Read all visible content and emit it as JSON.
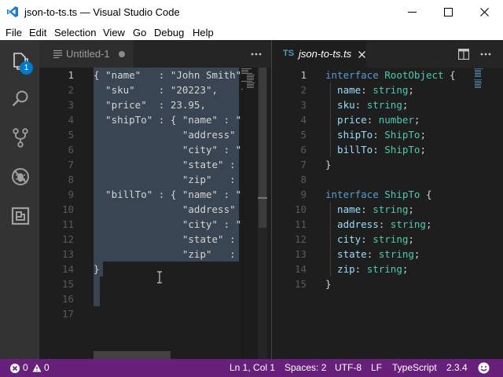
{
  "window": {
    "title": "json-to-ts.ts — Visual Studio Code"
  },
  "menu": [
    "File",
    "Edit",
    "Selection",
    "View",
    "Go",
    "Debug",
    "Help"
  ],
  "activity": {
    "explorer_badge": "1"
  },
  "left_editor": {
    "tab_label": "Untitled-1",
    "line_numbers": [
      "1",
      "2",
      "3",
      "4",
      "5",
      "6",
      "7",
      "8",
      "9",
      "10",
      "11",
      "12",
      "13",
      "14",
      "15",
      "16",
      "17"
    ],
    "lines": [
      "{ \"name\"   : \"John Smith\",",
      "  \"sku\"    : \"20223\",",
      "  \"price\"  : 23.95,",
      "  \"shipTo\" : { \"name\" : \"",
      "               \"address\"",
      "               \"city\" : \"",
      "               \"state\" : ",
      "               \"zip\"   : ",
      "  \"billTo\" : { \"name\" : \"",
      "               \"address\"",
      "               \"city\" : \"",
      "               \"state\" : ",
      "               \"zip\"   : ",
      "}",
      "",
      "",
      ""
    ]
  },
  "right_editor": {
    "tab_icon": "TS",
    "tab_label": "json-to-ts.ts",
    "line_numbers": [
      "1",
      "2",
      "3",
      "4",
      "5",
      "6",
      "7",
      "8",
      "9",
      "10",
      "11",
      "12",
      "13",
      "14",
      "15"
    ],
    "lines": [
      [
        [
          "kw",
          "interface "
        ],
        [
          "ty",
          "RootObject"
        ],
        [
          "pun",
          " {"
        ]
      ],
      [
        [
          "prop",
          "  name"
        ],
        [
          "pun",
          ": "
        ],
        [
          "ty",
          "string"
        ],
        [
          "pun",
          ";"
        ]
      ],
      [
        [
          "prop",
          "  sku"
        ],
        [
          "pun",
          ": "
        ],
        [
          "ty",
          "string"
        ],
        [
          "pun",
          ";"
        ]
      ],
      [
        [
          "prop",
          "  price"
        ],
        [
          "pun",
          ": "
        ],
        [
          "ty",
          "number"
        ],
        [
          "pun",
          ";"
        ]
      ],
      [
        [
          "prop",
          "  shipTo"
        ],
        [
          "pun",
          ": "
        ],
        [
          "ty",
          "ShipTo"
        ],
        [
          "pun",
          ";"
        ]
      ],
      [
        [
          "prop",
          "  billTo"
        ],
        [
          "pun",
          ": "
        ],
        [
          "ty",
          "ShipTo"
        ],
        [
          "pun",
          ";"
        ]
      ],
      [
        [
          "pun",
          "}"
        ]
      ],
      [],
      [
        [
          "kw",
          "interface "
        ],
        [
          "ty",
          "ShipTo"
        ],
        [
          "pun",
          " {"
        ]
      ],
      [
        [
          "prop",
          "  name"
        ],
        [
          "pun",
          ": "
        ],
        [
          "ty",
          "string"
        ],
        [
          "pun",
          ";"
        ]
      ],
      [
        [
          "prop",
          "  address"
        ],
        [
          "pun",
          ": "
        ],
        [
          "ty",
          "string"
        ],
        [
          "pun",
          ";"
        ]
      ],
      [
        [
          "prop",
          "  city"
        ],
        [
          "pun",
          ": "
        ],
        [
          "ty",
          "string"
        ],
        [
          "pun",
          ";"
        ]
      ],
      [
        [
          "prop",
          "  state"
        ],
        [
          "pun",
          ": "
        ],
        [
          "ty",
          "string"
        ],
        [
          "pun",
          ";"
        ]
      ],
      [
        [
          "prop",
          "  zip"
        ],
        [
          "pun",
          ": "
        ],
        [
          "ty",
          "string"
        ],
        [
          "pun",
          ";"
        ]
      ],
      [
        [
          "pun",
          "}"
        ]
      ]
    ]
  },
  "status": {
    "errors": "0",
    "warnings": "0",
    "position": "Ln 1, Col 1",
    "spaces": "Spaces: 2",
    "encoding": "UTF-8",
    "eol": "LF",
    "language": "TypeScript",
    "version": "2.3.4"
  },
  "colors": {
    "activity_bar": "#333333",
    "status_bar": "#68217a",
    "editor_bg": "#1e1e1e",
    "selection": "#3a4553",
    "keyword": "#569cd6",
    "type": "#4ec9b0",
    "property": "#9cdcfe"
  }
}
